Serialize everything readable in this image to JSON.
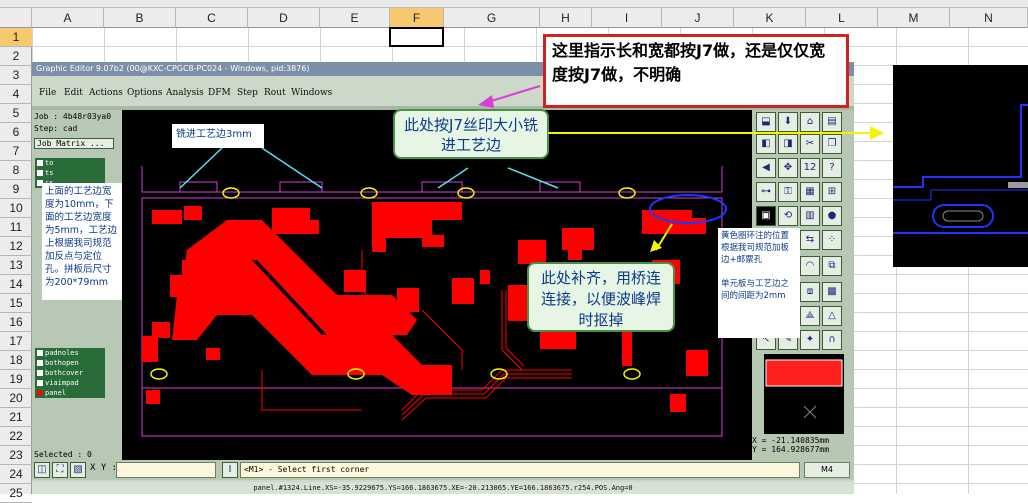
{
  "spreadsheet": {
    "columns": [
      "A",
      "B",
      "C",
      "D",
      "E",
      "F",
      "G",
      "H",
      "I",
      "J",
      "K",
      "L",
      "M",
      "N"
    ],
    "rows": [
      "1",
      "2",
      "3",
      "4",
      "5",
      "6",
      "7",
      "8",
      "9",
      "10",
      "11",
      "12",
      "13",
      "14",
      "15",
      "16",
      "17",
      "18",
      "19",
      "20",
      "21",
      "22",
      "23",
      "24",
      "25"
    ],
    "selected_column": "F",
    "selected_row": "1"
  },
  "annotations": {
    "top_right_note": "这里指示长和宽都按J7做，还是仅仅宽度按J7做，不明确",
    "silkscreen_note": "此处按J7丝印大小铣进工艺边",
    "bridge_note": "此处补齐，用桥连连接，以便波峰焊时抠掉",
    "milling_label": "铣进工艺边3mm",
    "process_edge_note": "上面的工艺边宽度为10mm，下面的工艺边宽度为5mm，工艺边上根据我司规范加反点与定位孔。拼板后尺寸为200*79mm",
    "hole_note": "黄色圈环注的位置根据我司规范加板边+邮票孔\n\n单元板与工艺边之间的间距为2mm"
  },
  "editor": {
    "title": "Graphic Editor 9.07b2 (00@KXC-CPGC8-PC024 - Windows, pid:3876)",
    "menu": [
      "File",
      "Edit",
      "Actions",
      "Options",
      "Analysis",
      "DFM",
      "Step",
      "Rout",
      "Windows"
    ],
    "job": "Job : 4b48r03ya0",
    "step": "Step: cad",
    "job_matrix": "Job Matrix ...",
    "layers": [
      "to",
      "ts",
      "cs",
      "",
      "",
      "",
      "",
      "",
      "",
      "",
      "",
      "",
      "",
      "",
      "",
      "padnoles",
      "bothopen",
      "bothcover",
      "viaimpad",
      "panel"
    ],
    "selected": "Selected : 0",
    "xy_label": "X Y :",
    "prompt": "<M1> - Select first corner",
    "mode_button": "M4",
    "coord_x": "X  = -21.140835mm",
    "coord_y": "Y  = 164.928677mm",
    "status_line": "panel.#1324.Line.XS=-35.9229675.YS=166.1863675.XE=-20.213065.YE=166.1863675.r254.POS.Ang=0",
    "icon_number": "12"
  },
  "colors": {
    "pcb_copper": "#ff0000",
    "pcb_background": "#000000",
    "annotation_arrow_yellow": "#f5f500",
    "annotation_arrow_cyan": "#5ae0ee",
    "outline_magenta": "#d93cd9",
    "highlight_ellipse_blue": "#1a3aff",
    "note_border_red": "#cc2222",
    "selected_header": "#f6c971"
  }
}
